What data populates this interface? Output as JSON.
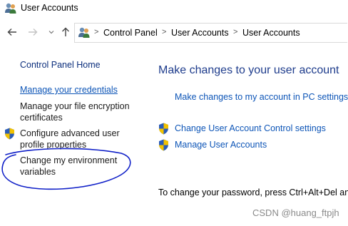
{
  "window": {
    "title": "User Accounts"
  },
  "nav": {
    "back_icon": "arrow-left-icon",
    "forward_icon": "arrow-right-icon",
    "recent_icon": "chevron-down-icon",
    "up_icon": "arrow-up-icon"
  },
  "breadcrumb": {
    "items": [
      "Control Panel",
      "User Accounts",
      "User Accounts"
    ],
    "separator": ">"
  },
  "left_pane": {
    "home": "Control Panel Home",
    "manage_credentials": "Manage your credentials",
    "file_encryption": "Manage your file encryption certificates",
    "advanced_profile": "Configure advanced user profile properties",
    "environment_variables": "Change my environment variables"
  },
  "main": {
    "heading": "Make changes to your user account",
    "pc_settings_link": "Make changes to my account in PC settings",
    "uac_link": "Change User Account Control settings",
    "manage_accounts_link": "Manage User Accounts",
    "password_text": "To change your password, press Ctrl+Alt+Del and s"
  },
  "watermark": "CSDN @huang_ftpjh",
  "colors": {
    "link": "#0d55b7",
    "heading": "#1e3c8c",
    "annotation": "#1020c8"
  }
}
